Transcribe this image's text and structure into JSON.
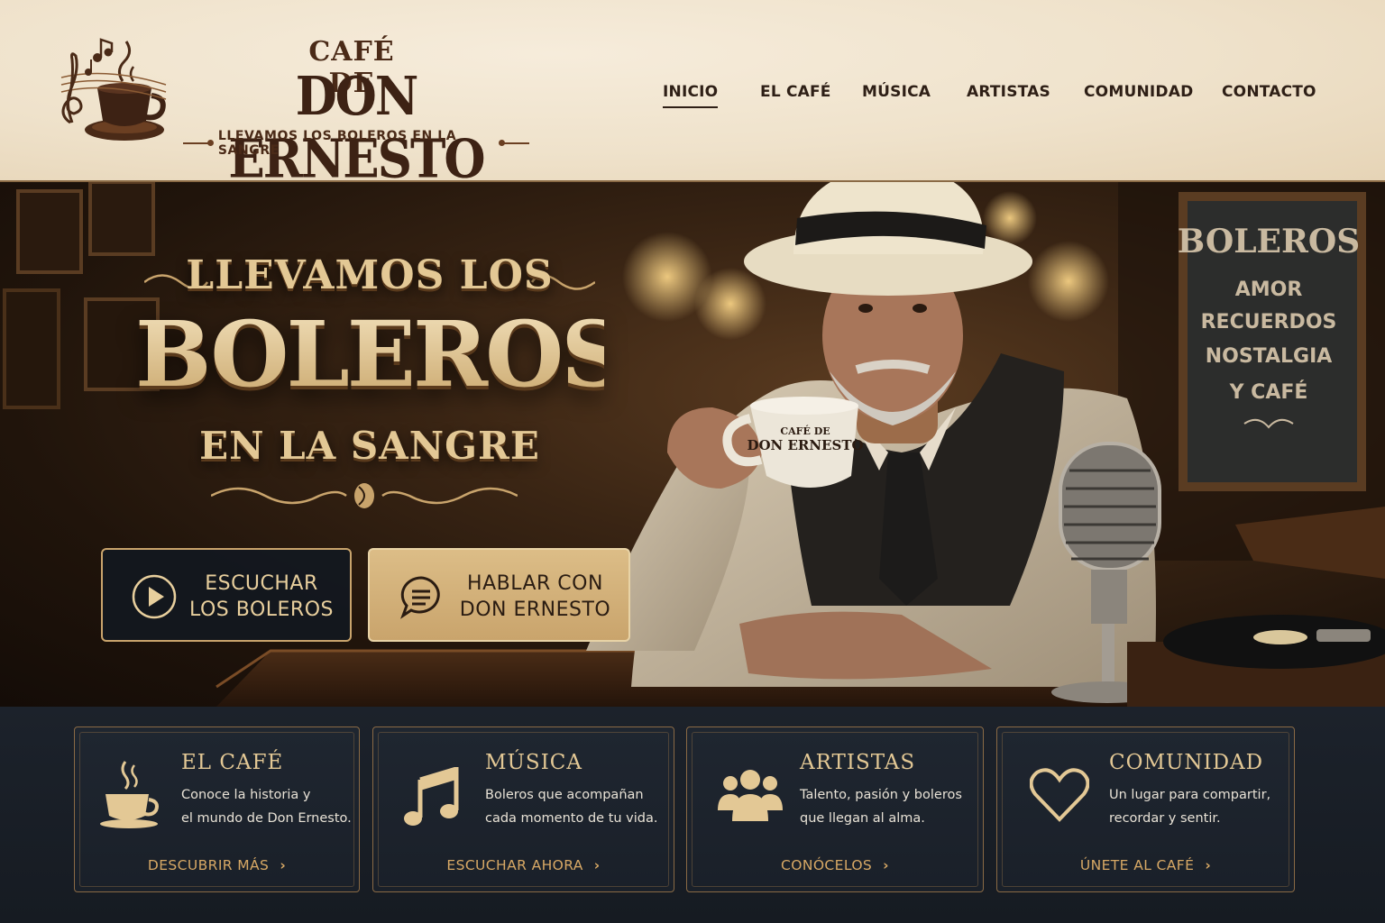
{
  "brand": {
    "line1": "CAFÉ DE",
    "line2": "DON ERNESTO",
    "tagline": "LLEVAMOS LOS BOLEROS EN LA SANGRE"
  },
  "nav": {
    "items": [
      {
        "label": "INICIO",
        "active": true
      },
      {
        "label": "EL CAFÉ",
        "active": false
      },
      {
        "label": "MÚSICA",
        "active": false
      },
      {
        "label": "ARTISTAS",
        "active": false
      },
      {
        "label": "COMUNIDAD",
        "active": false
      },
      {
        "label": "CONTACTO",
        "active": false
      }
    ]
  },
  "hero": {
    "line1": "LLEVAMOS LOS",
    "line2": "BOLEROS",
    "line3": "EN LA SANGRE",
    "cup_text_top": "CAFÉ DE",
    "cup_text_main": "DON ERNESTO",
    "sign": [
      "BOLEROS",
      "AMOR",
      "RECUERDOS",
      "NOSTALGIA",
      "Y CAFÉ"
    ],
    "cta_listen": {
      "line1": "ESCUCHAR",
      "line2": "LOS BOLEROS",
      "icon": "play-icon"
    },
    "cta_talk": {
      "line1": "HABLAR CON",
      "line2": "DON ERNESTO",
      "icon": "chat-icon"
    }
  },
  "cards": [
    {
      "title": "EL CAFÉ",
      "desc1": "Conoce la historia y",
      "desc2": "el mundo de Don Ernesto.",
      "link": "DESCUBRIR MÁS",
      "icon": "coffee-cup-icon"
    },
    {
      "title": "MÚSICA",
      "desc1": "Boleros que acompañan",
      "desc2": "cada momento de tu vida.",
      "link": "ESCUCHAR AHORA",
      "icon": "music-note-icon"
    },
    {
      "title": "ARTISTAS",
      "desc1": "Talento, pasión y boleros",
      "desc2": "que llegan al alma.",
      "link": "CONÓCELOS",
      "icon": "people-icon"
    },
    {
      "title": "COMUNIDAD",
      "desc1": "Un lugar para compartir,",
      "desc2": "recordar y sentir.",
      "link": "ÚNETE AL CAFÉ",
      "icon": "heart-icon"
    }
  ],
  "colors": {
    "header_bg": "#efe2cb",
    "brand_brown": "#3d2214",
    "gold": "#d7a865",
    "navy": "#1a2029"
  }
}
